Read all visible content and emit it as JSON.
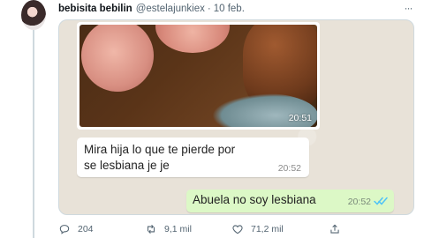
{
  "tweet": {
    "display_name": "bebisita bebilin",
    "handle": "@estelajunkiex",
    "separator": "·",
    "date": "10 feb.",
    "more": "···"
  },
  "chat": {
    "photo_time": "20:51",
    "received": {
      "text": "Mira hija lo que te pierde por\nse lesbiana je je",
      "time": "20:52"
    },
    "sent": {
      "text": "Abuela no soy lesbiana",
      "time": "20:52",
      "status_icon": "double-check-icon",
      "status_color": "#4fc3f7"
    }
  },
  "actions": {
    "reply_count": "204",
    "retweet_count": "9,1 mil",
    "like_count": "71,2 mil",
    "share_icon": "share-icon"
  },
  "colors": {
    "muted": "#536471",
    "sent_bubble": "#dcf8c6",
    "chat_bg": "#e8e2d8"
  }
}
